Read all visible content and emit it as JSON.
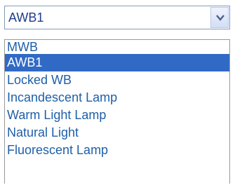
{
  "select": {
    "value": "AWB1",
    "arrow_icon": "chevron-down-icon"
  },
  "options": [
    {
      "label": "MWB",
      "selected": false
    },
    {
      "label": "AWB1",
      "selected": true
    },
    {
      "label": "Locked WB",
      "selected": false
    },
    {
      "label": "Incandescent Lamp",
      "selected": false
    },
    {
      "label": "Warm Light Lamp",
      "selected": false
    },
    {
      "label": "Natural Light",
      "selected": false
    },
    {
      "label": "Fluorescent Lamp",
      "selected": false
    }
  ],
  "colors": {
    "option_text": "#1f5fa8",
    "selected_bg": "#316ac5",
    "selected_text": "#ffffff",
    "border": "#7f9db9"
  }
}
